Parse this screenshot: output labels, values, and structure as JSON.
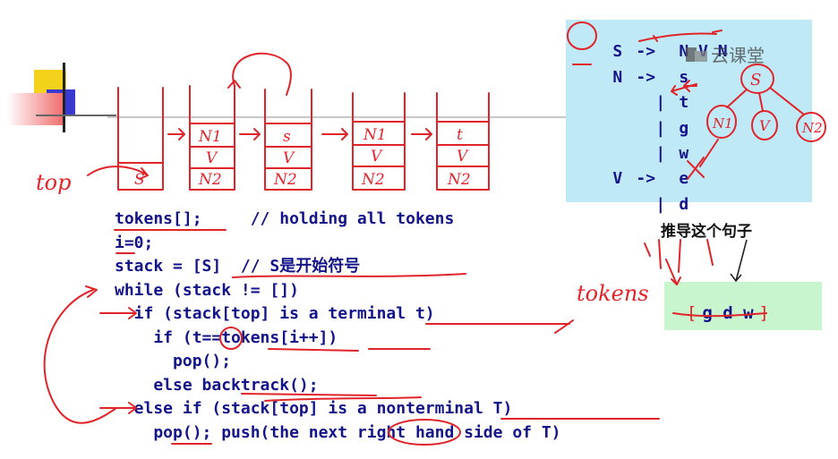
{
  "watermark": {
    "text": "云课堂"
  },
  "grammar": {
    "rules": [
      {
        "lhs": "S",
        "arrow": "->",
        "rhs": "N V N"
      },
      {
        "lhs": "N",
        "arrow": "->",
        "rhs": "s"
      },
      {
        "lhs": "",
        "arrow": "|",
        "rhs": "t"
      },
      {
        "lhs": "",
        "arrow": "|",
        "rhs": "g"
      },
      {
        "lhs": "",
        "arrow": "|",
        "rhs": "w"
      },
      {
        "lhs": "V",
        "arrow": "->",
        "rhs": "e"
      },
      {
        "lhs": "",
        "arrow": "|",
        "rhs": "d"
      }
    ]
  },
  "code": {
    "lines": [
      "tokens[];     // holding all tokens",
      "i=0;",
      "stack = [S]  // S是开始符号",
      "while (stack != [])",
      "  if (stack[top] is a terminal t)",
      "    if (t==tokens[i++])",
      "      pop();",
      "    else backtrack();",
      "  else if (stack[top] is a nonterminal T)",
      "    pop(); push(the next right hand side of T)"
    ]
  },
  "sentence": {
    "caption": "推导这个句子",
    "tokens_open": "[",
    "tokens": "g d w",
    "tokens_close": "]"
  },
  "annotations": {
    "top_label": "top",
    "tokens_label": "tokens",
    "tree_root": "S",
    "tree_children": [
      "N1",
      "V",
      "N2"
    ],
    "stack_frames": [
      [
        "S"
      ],
      [
        "N1",
        "V",
        "N2"
      ],
      [
        "s",
        "V",
        "N2"
      ],
      [
        "N1",
        "V",
        "N2"
      ],
      [
        "t",
        "V",
        "N2"
      ]
    ]
  },
  "colors": {
    "code_text": "#13138a",
    "ink": "#e0242a",
    "grammar_panel": "#bfe9f7",
    "token_panel": "#c8f5cd"
  }
}
